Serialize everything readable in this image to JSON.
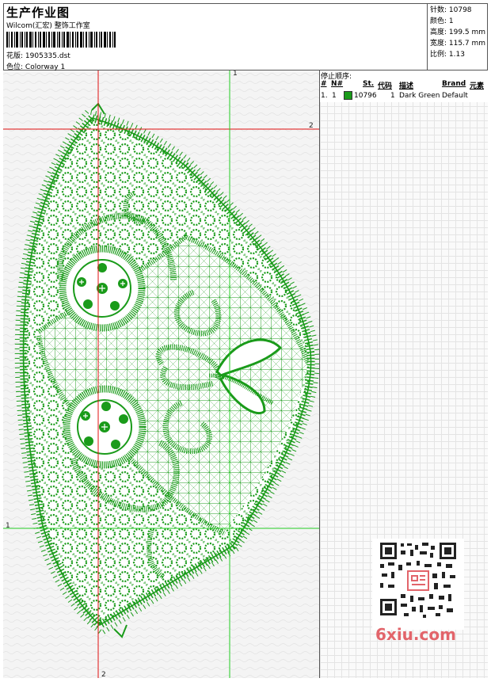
{
  "header": {
    "title": "生产作业图",
    "company": "Wilcom(汇宏) 整饰工作室",
    "design_label": "花版:",
    "design_file": "1905335.dst",
    "colorway_label": "色位:",
    "colorway": "Colorway 1"
  },
  "stats": {
    "stitches": "针数: 10798",
    "colors": "颜色: 1",
    "height": "高度: 199.5 mm",
    "width": "宽度: 115.7 mm",
    "scale": "比例: 1.13"
  },
  "stop_sequence": {
    "title": "停止顺序:",
    "columns": [
      "#",
      "N#",
      "St.",
      "代码",
      "描述",
      "Brand",
      "元素"
    ],
    "rows": [
      {
        "num": "1.",
        "n": "1",
        "stitches": "10796",
        "code": "1",
        "description": "Dark Green",
        "brand": "Default",
        "color": "#1a9b1a"
      }
    ]
  },
  "guides": {
    "left_top": "1",
    "left_side": "1",
    "red_top": "2",
    "red_bottom": "2"
  },
  "colors": {
    "thread": "#1a9b1a",
    "guide_red": "#e01010",
    "guide_green": "#22cc22",
    "logo": "#e2646a"
  },
  "watermark": {
    "logo_text": "6xiu.com"
  }
}
